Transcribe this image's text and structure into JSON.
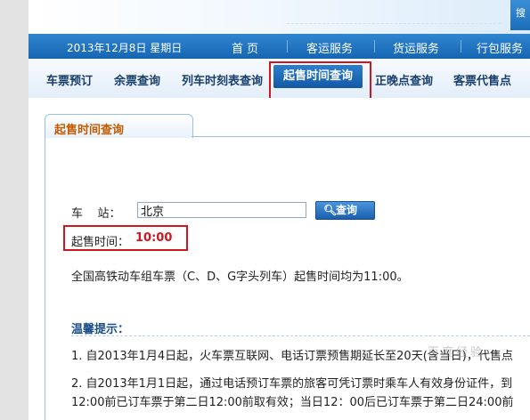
{
  "header": {
    "date_text": "2013年12月8日 星期日",
    "corner_text": "搜"
  },
  "nav": {
    "items": [
      {
        "label": "首  页"
      },
      {
        "label": "客运服务"
      },
      {
        "label": "货运服务"
      },
      {
        "label": "行包服务"
      }
    ]
  },
  "subnav": {
    "items": [
      {
        "label": "车票预订"
      },
      {
        "label": "余票查询"
      },
      {
        "label": "列车时刻表查询"
      },
      {
        "label": "起售时间查询",
        "active": true
      },
      {
        "label": "正晚点查询"
      },
      {
        "label": "客票代售点"
      }
    ]
  },
  "panel": {
    "title": "起售时间查询"
  },
  "form": {
    "station_label": "车    站：",
    "station_value": "北京",
    "query_button": "查询",
    "query_icon": "search-icon"
  },
  "result": {
    "sale_time_label": "起售时间：",
    "sale_time_value": "10:00"
  },
  "notice": "全国高铁动车组车票（C、D、G字头列车）起售时间均为11:00。",
  "tips": {
    "title": "温馨提示：",
    "items": [
      "1. 自2013年1月4日起，火车票互联网、电话订票预售期延长至20天(含当日)，代售点",
      "2. 自2013年1月1日起，通过电话预订车票的旅客可凭订票时乘车人有效身份证件，到",
      "12:00前已订车票于第二日12:00前取有效；当日12：00后已订车票于第二日24:00前"
    ]
  },
  "watermark": "百度经验",
  "colors": {
    "nav_blue": "#1765b2",
    "active_tab": "#1259a6",
    "highlight_red": "#d0171f",
    "panel_title": "#c35a00"
  }
}
